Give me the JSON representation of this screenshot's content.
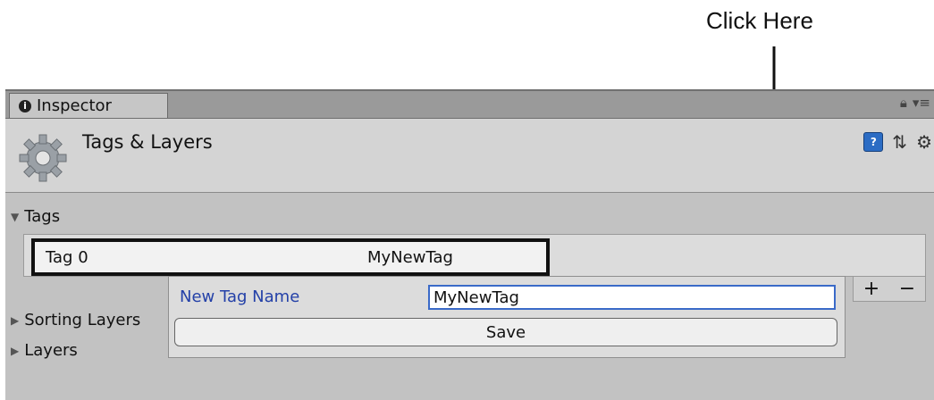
{
  "annotation": {
    "text": "Click Here"
  },
  "tab": {
    "info_glyph": "i",
    "label": "Inspector",
    "lock_icon": "lock-icon",
    "menu_icon": "menu-icon"
  },
  "header": {
    "title": "Tags & Layers",
    "icons": [
      "help-icon",
      "preset-icon",
      "gear-icon"
    ]
  },
  "sections": {
    "tags": "Tags",
    "sorting_layers": "Sorting Layers",
    "layers": "Layers"
  },
  "tags": [
    {
      "name": "Tag 0",
      "value": "MyNewTag"
    }
  ],
  "list_controls": {
    "add": "+",
    "remove": "−"
  },
  "new_tag_popup": {
    "label": "New Tag Name",
    "value": "MyNewTag",
    "save_label": "Save"
  }
}
